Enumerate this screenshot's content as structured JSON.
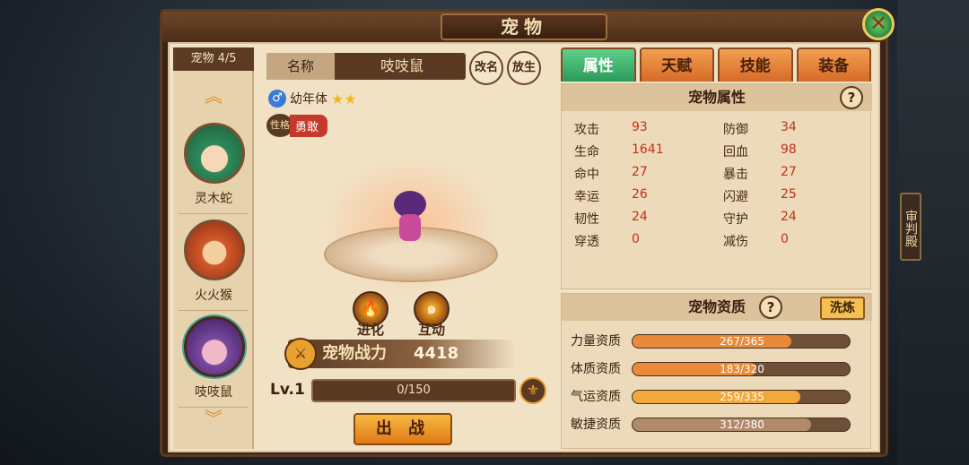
{
  "window": {
    "title": "宠物",
    "side_tag": "审判殿"
  },
  "petlist": {
    "count_label": "宠物 4/5",
    "pets": [
      {
        "name": "灵木蛇"
      },
      {
        "name": "火火猴"
      },
      {
        "name": "吱吱鼠"
      }
    ]
  },
  "detail": {
    "name_label": "名称",
    "name_value": "吱吱鼠",
    "btn_rename": "改名",
    "btn_release": "放生",
    "gender_symbol": "♂",
    "age_stage": "幼年体",
    "stars": "★★",
    "trait_label": "性格",
    "trait_value": "勇敢",
    "btn_evolve": "进化",
    "btn_interact": "互动",
    "power_label": "宠物战力",
    "power_value": "4418",
    "level": "Lv.1",
    "exp_text": "0/150",
    "exp_fraction": 0,
    "deploy_label": "出 战"
  },
  "tabs": [
    {
      "label": "属性",
      "active": true
    },
    {
      "label": "天赋",
      "active": false
    },
    {
      "label": "技能",
      "active": false
    },
    {
      "label": "装备",
      "active": false
    }
  ],
  "attributes": {
    "header": "宠物属性",
    "help": "?",
    "rows": [
      {
        "l_name": "攻击",
        "l_val": "93",
        "r_name": "防御",
        "r_val": "34"
      },
      {
        "l_name": "生命",
        "l_val": "1641",
        "r_name": "回血",
        "r_val": "98"
      },
      {
        "l_name": "命中",
        "l_val": "27",
        "r_name": "暴击",
        "r_val": "27"
      },
      {
        "l_name": "幸运",
        "l_val": "26",
        "r_name": "闪避",
        "r_val": "25"
      },
      {
        "l_name": "韧性",
        "l_val": "24",
        "r_name": "守护",
        "r_val": "24"
      },
      {
        "l_name": "穿透",
        "l_val": "0",
        "r_name": "减伤",
        "r_val": "0"
      }
    ]
  },
  "aptitude": {
    "header": "宠物资质",
    "help": "?",
    "refine_label": "洗炼",
    "rows": [
      {
        "name": "力量资质",
        "text": "267/365",
        "value": 267,
        "max": 365,
        "color": "#e88a3a"
      },
      {
        "name": "体质资质",
        "text": "183/320",
        "value": 183,
        "max": 320,
        "color": "#e88a3a"
      },
      {
        "name": "气运资质",
        "text": "259/335",
        "value": 259,
        "max": 335,
        "color": "#f2a83a"
      },
      {
        "name": "敏捷资质",
        "text": "312/380",
        "value": 312,
        "max": 380,
        "color": "#b08a6a"
      }
    ]
  }
}
